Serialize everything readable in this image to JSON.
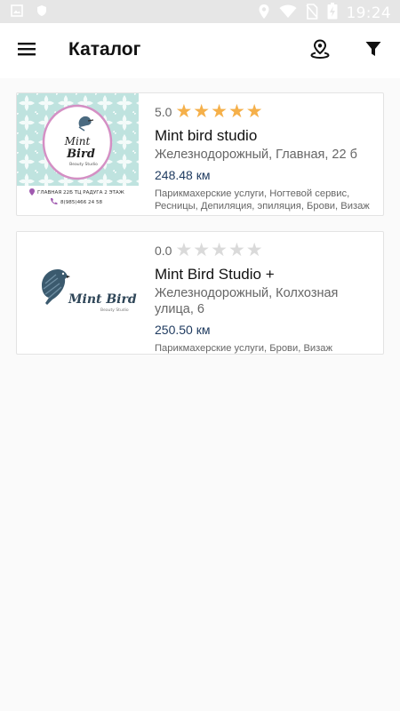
{
  "status_bar": {
    "time": "19:24",
    "icons": [
      "image-icon",
      "vpn-icon",
      "location-icon",
      "wifi-icon",
      "no-sim-icon",
      "battery-charging-icon"
    ]
  },
  "app_bar": {
    "title": "Каталог",
    "icons": [
      "menu-icon",
      "map-pin-icon",
      "filter-icon"
    ]
  },
  "salons": [
    {
      "rating": "5.0",
      "stars": 5,
      "name": "Mint bird studio",
      "address": "Железнодорожный, Главная, 22 б",
      "distance": "248.48 км",
      "services": "Парикмахерские услуги, Ногтевой сервис, Ресницы, Депиляция,  эпиляция, Брови, Визаж",
      "thumb": {
        "logo_line1": "Mint",
        "logo_line2": "Bird",
        "logo_sub": "Beauty Studio",
        "address_line": "ГЛАВНАЯ 22Б ТЦ РАДУГА 2 ЭТАЖ",
        "phone_line": "8(985)466 24 58"
      }
    },
    {
      "rating": "0.0",
      "stars": 0,
      "name": "Mint Bird Studio +",
      "address": "Железнодорожный, Колхозная улица, 6",
      "distance": "250.50 км",
      "services": "Парикмахерские услуги, Брови, Визаж",
      "thumb": {
        "logo_line1": "Mint Bird",
        "logo_sub": "Beauty Studio"
      }
    }
  ],
  "colors": {
    "star_on": "#f5b04a",
    "star_off": "#dadada",
    "distance": "#1e3a5f",
    "thumb1_bg": "#bfe3df",
    "thumb1_frame": "#d48fc4"
  }
}
